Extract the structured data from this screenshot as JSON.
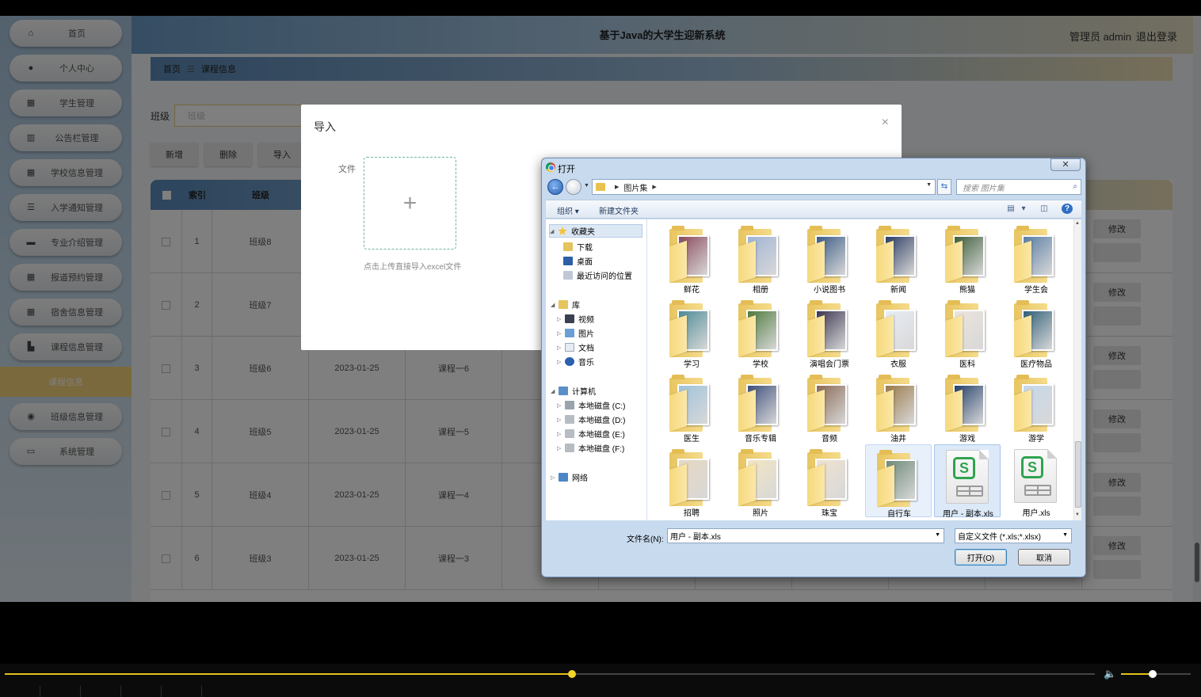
{
  "app": {
    "title": "基于Java的大学生迎新系统",
    "user_role": "管理员 admin",
    "logout": "退出登录"
  },
  "sidebar": {
    "items": [
      {
        "label": "首页",
        "icon": "home-icon"
      },
      {
        "label": "个人中心",
        "icon": "user-icon"
      },
      {
        "label": "学生管理",
        "icon": "grid-icon"
      },
      {
        "label": "公告栏管理",
        "icon": "chart-icon"
      },
      {
        "label": "学校信息管理",
        "icon": "grid-icon"
      },
      {
        "label": "入学通知管理",
        "icon": "list-icon"
      },
      {
        "label": "专业介绍管理",
        "icon": "briefcase-icon"
      },
      {
        "label": "报道预约管理",
        "icon": "grid-icon"
      },
      {
        "label": "宿舍信息管理",
        "icon": "grid-icon"
      },
      {
        "label": "课程信息管理",
        "icon": "bar-chart-icon"
      },
      {
        "label": "班级信息管理",
        "icon": "pin-icon"
      },
      {
        "label": "系统管理",
        "icon": "monitor-icon"
      }
    ],
    "active_sub": "课程信息"
  },
  "breadcrumb": {
    "home": "首页",
    "current": "课程信息"
  },
  "filter": {
    "label": "班级",
    "placeholder": "班级"
  },
  "toolbar": {
    "add": "新增",
    "delete": "删除",
    "import": "导入"
  },
  "table": {
    "headers": {
      "index": "索引",
      "class": "班级"
    },
    "row_action": "修改",
    "rows": [
      {
        "index": "1",
        "class": "班级8",
        "date": "",
        "course": ""
      },
      {
        "index": "2",
        "class": "班级7",
        "date": "",
        "course": ""
      },
      {
        "index": "3",
        "class": "班级6",
        "date": "2023-01-25",
        "course": "课程一6"
      },
      {
        "index": "4",
        "class": "班级5",
        "date": "2023-01-25",
        "course": "课程一5"
      },
      {
        "index": "5",
        "class": "班级4",
        "date": "2023-01-25",
        "course": "课程一4"
      },
      {
        "index": "6",
        "class": "班级3",
        "date": "2023-01-25",
        "course": "课程一3"
      }
    ]
  },
  "modal": {
    "title": "导入",
    "file_label": "文件",
    "upload_plus": "+",
    "upload_hint": "点击上传直接导入excel文件",
    "close": "×"
  },
  "dialog": {
    "title": "打开",
    "close": "✕",
    "path": "图片集",
    "search_placeholder": "搜索 图片集",
    "organize": "组织",
    "new_folder": "新建文件夹",
    "tree": {
      "favorites": "收藏夹",
      "downloads": "下载",
      "desktop": "桌面",
      "recent": "最近访问的位置",
      "library": "库",
      "videos": "视频",
      "pictures": "图片",
      "documents": "文档",
      "music": "音乐",
      "computer": "计算机",
      "disk_c": "本地磁盘 (C:)",
      "disk_d": "本地磁盘 (D:)",
      "disk_e": "本地磁盘 (E:)",
      "disk_f": "本地磁盘 (F:)",
      "network": "网络"
    },
    "files": [
      {
        "name": "鲜花",
        "kind": "folder",
        "color": "#8a4a5c"
      },
      {
        "name": "相册",
        "kind": "folder",
        "color": "#9fb4d6"
      },
      {
        "name": "小说图书",
        "kind": "folder",
        "color": "#3b5b86"
      },
      {
        "name": "新闻",
        "kind": "folder",
        "color": "#2c3d63"
      },
      {
        "name": "熊猫",
        "kind": "folder",
        "color": "#3e5e3a"
      },
      {
        "name": "学生会",
        "kind": "folder",
        "color": "#5a7ea6"
      },
      {
        "name": "学习",
        "kind": "folder",
        "color": "#4d8b96"
      },
      {
        "name": "学校",
        "kind": "folder",
        "color": "#4e7a3c"
      },
      {
        "name": "演唱会门票",
        "kind": "folder",
        "color": "#3b3550"
      },
      {
        "name": "衣服",
        "kind": "folder",
        "color": "#e8eef5"
      },
      {
        "name": "医科",
        "kind": "folder",
        "color": "#ece4dc"
      },
      {
        "name": "医疗物品",
        "kind": "folder",
        "color": "#2f5f78"
      },
      {
        "name": "医生",
        "kind": "folder",
        "color": "#9fc3dc"
      },
      {
        "name": "音乐专辑",
        "kind": "folder",
        "color": "#3d4f7a"
      },
      {
        "name": "音频",
        "kind": "folder",
        "color": "#8b6a55"
      },
      {
        "name": "油井",
        "kind": "folder",
        "color": "#9a7a4a"
      },
      {
        "name": "游戏",
        "kind": "folder",
        "color": "#24406b"
      },
      {
        "name": "游学",
        "kind": "folder",
        "color": "#c6d7ea"
      },
      {
        "name": "招聘",
        "kind": "folder",
        "color": "#e7d8c0"
      },
      {
        "name": "照片",
        "kind": "folder",
        "color": "#f3e6c0"
      },
      {
        "name": "珠宝",
        "kind": "folder",
        "color": "#f0e2d0"
      },
      {
        "name": "自行车",
        "kind": "folder",
        "color": "#6f8a7a"
      },
      {
        "name": "用户 - 副本.xls",
        "kind": "xls",
        "color": "#2ea44f"
      },
      {
        "name": "用户.xls",
        "kind": "xls",
        "color": "#2ea44f"
      }
    ],
    "filename_label": "文件名(N):",
    "filename_value": "用户 - 副本.xls",
    "filetype_value": "自定义文件 (*.xls;*.xlsx)",
    "open_button": "打开(O)",
    "cancel_button": "取消"
  },
  "player": {
    "progress": 0.52,
    "volume": 0.45,
    "accent": "#e2c21b"
  }
}
